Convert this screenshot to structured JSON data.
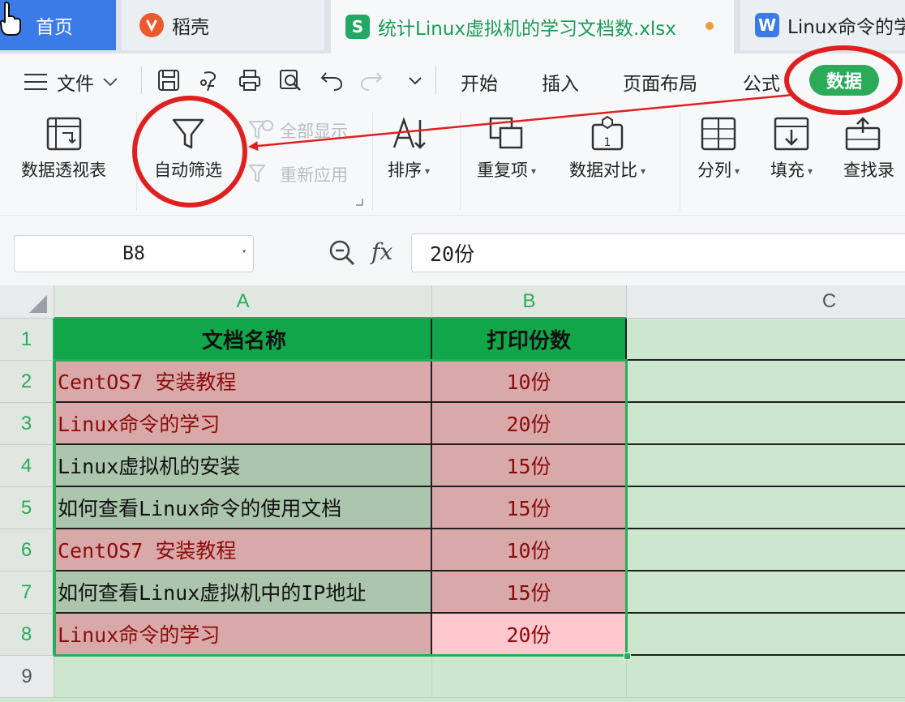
{
  "tabs": {
    "home": "首页",
    "daoke": "稻壳",
    "active": "统计Linux虚拟机的学习文档数.xlsx",
    "w_doc": "Linux命令的学"
  },
  "menu": {
    "file": "文件",
    "start": "开始",
    "insert": "插入",
    "layout": "页面布局",
    "formula": "公式",
    "data": "数据"
  },
  "ribbon": {
    "pivot": "数据透视表",
    "autofilter": "自动筛选",
    "show_all": "全部显示",
    "reapply": "重新应用",
    "sort": "排序",
    "duplicates": "重复项",
    "compare": "数据对比",
    "split": "分列",
    "fill": "填充",
    "lookup": "查找录"
  },
  "formula_bar": {
    "cell_ref": "B8",
    "fx": "fx",
    "value": "20份"
  },
  "grid": {
    "columns": [
      "A",
      "B",
      "C"
    ],
    "rows": [
      "1",
      "2",
      "3",
      "4",
      "5",
      "6",
      "7",
      "8",
      "9"
    ],
    "header": [
      "文档名称",
      "打印份数"
    ],
    "data": [
      {
        "name": "CentOS7 安装教程",
        "count": "10份"
      },
      {
        "name": "Linux命令的学习",
        "count": "20份"
      },
      {
        "name": "Linux虚拟机的安装",
        "count": "15份"
      },
      {
        "name": "如何查看Linux命令的使用文档",
        "count": "15份"
      },
      {
        "name": "CentOS7 安装教程",
        "count": "10份"
      },
      {
        "name": "如何查看Linux虚拟机中的IP地址",
        "count": "15份"
      },
      {
        "name": "Linux命令的学习",
        "count": "20份"
      }
    ]
  },
  "colors": {
    "accent": "#2bab5a",
    "header_fill": "#12a64b",
    "dup_fill": "#d8a9a8",
    "dup_text": "#8c0c0c",
    "annotation": "#e02020"
  }
}
